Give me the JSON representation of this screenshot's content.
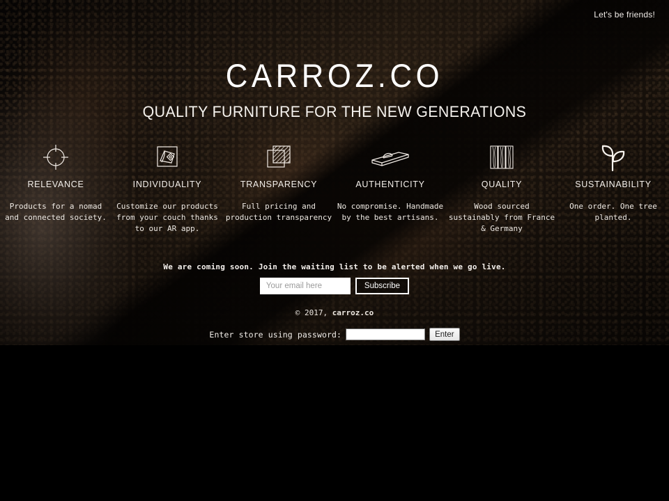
{
  "window": {
    "background_color": "#000000",
    "page_background_color": "#1d150e"
  },
  "header": {
    "friends_link": "Let's be friends!",
    "logo": "CARROZ.CO",
    "tagline": "QUALITY FURNITURE FOR THE NEW GENERATIONS"
  },
  "features": [
    {
      "icon": "crosshair-target-icon",
      "title": "RELEVANCE",
      "description": "Products for a nomad and connected society."
    },
    {
      "icon": "framed-sketch-icon",
      "title": "INDIVIDUALITY",
      "description": "Customize our products from your couch thanks to our AR app."
    },
    {
      "icon": "overlapping-hatched-squares-icon",
      "title": "TRANSPARENCY",
      "description": "Full pricing and production transparency"
    },
    {
      "icon": "hand-plane-icon",
      "title": "AUTHENTICITY",
      "description": "No compromise. Handmade by the best artisans."
    },
    {
      "icon": "wood-planks-icon",
      "title": "QUALITY",
      "description": "Wood sourced sustainably from France & Germany"
    },
    {
      "icon": "seedling-sprout-icon",
      "title": "SUSTAINABILITY",
      "description": "One order. One tree planted."
    }
  ],
  "signup": {
    "note": "We are coming soon. Join the waiting list to be alerted when we go live.",
    "email_placeholder": "Your email here",
    "email_value": "",
    "subscribe_label": "Subscribe"
  },
  "footer": {
    "copyright_prefix": "© 2017, ",
    "copyright_site": "carroz.co"
  },
  "password_bar": {
    "label": "Enter store using password:",
    "password_value": "",
    "enter_label": "Enter"
  },
  "colors": {
    "text": "#ffffff",
    "input_background": "#ffffff",
    "button_face": "#e6e6e6",
    "page_dark": "#120d09"
  }
}
